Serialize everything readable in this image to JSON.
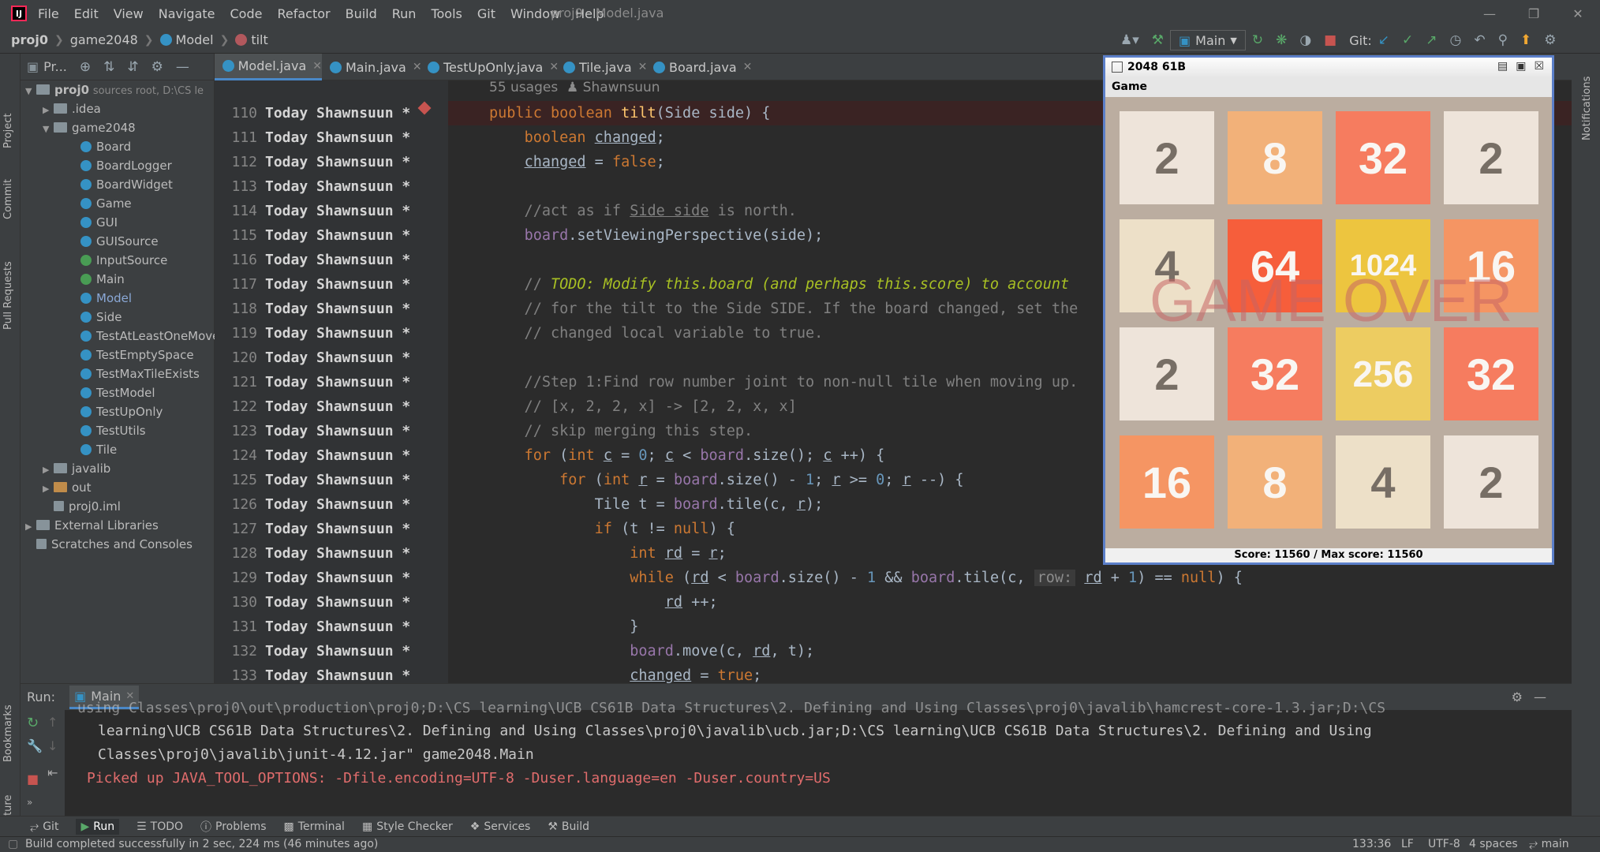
{
  "app": {
    "logo": "IJ",
    "window_title": "proj0 - Model.java",
    "menu": [
      "File",
      "Edit",
      "View",
      "Navigate",
      "Code",
      "Refactor",
      "Build",
      "Run",
      "Tools",
      "Git",
      "Window",
      "Help"
    ]
  },
  "breadcrumb": {
    "project": "proj0",
    "module": "game2048",
    "class": "Model",
    "method": "tilt"
  },
  "toolbar": {
    "run_config": "Main",
    "git_label": "Git:"
  },
  "project_panel": {
    "title": "Pr...",
    "items": [
      {
        "label": "proj0",
        "extra": "sources root, D:\\CS le"
      },
      {
        "label": ".idea"
      },
      {
        "label": "game2048"
      },
      {
        "label": "Board"
      },
      {
        "label": "BoardLogger"
      },
      {
        "label": "BoardWidget"
      },
      {
        "label": "Game"
      },
      {
        "label": "GUI"
      },
      {
        "label": "GUISource"
      },
      {
        "label": "InputSource"
      },
      {
        "label": "Main"
      },
      {
        "label": "Model"
      },
      {
        "label": "Side"
      },
      {
        "label": "TestAtLeastOneMoveE"
      },
      {
        "label": "TestEmptySpace"
      },
      {
        "label": "TestMaxTileExists"
      },
      {
        "label": "TestModel"
      },
      {
        "label": "TestUpOnly"
      },
      {
        "label": "TestUtils"
      },
      {
        "label": "Tile"
      },
      {
        "label": "javalib"
      },
      {
        "label": "out"
      },
      {
        "label": "proj0.iml"
      },
      {
        "label": "External Libraries"
      },
      {
        "label": "Scratches and Consoles"
      }
    ]
  },
  "editor_tabs": [
    "Model.java",
    "Main.java",
    "TestUpOnly.java",
    "Tile.java",
    "Board.java"
  ],
  "usages": "55 usages",
  "usage_author": "Shawnsuun",
  "annotation": {
    "date": "Today",
    "author": "Shawnsuun",
    "mark": "*"
  },
  "line_numbers": [
    "110",
    "111",
    "112",
    "113",
    "114",
    "115",
    "116",
    "117",
    "118",
    "119",
    "120",
    "121",
    "122",
    "123",
    "124",
    "125",
    "126",
    "127",
    "128",
    "129",
    "130",
    "131",
    "132",
    "133"
  ],
  "game": {
    "window_title": "2048 61B",
    "menu": "Game",
    "tiles": [
      "2",
      "8",
      "32",
      "2",
      "4",
      "64",
      "1024",
      "16",
      "2",
      "32",
      "256",
      "32",
      "16",
      "8",
      "4",
      "2"
    ],
    "overlay": "GAME OVER",
    "score_text": "Score:  11560 / Max score:  11560"
  },
  "run": {
    "label": "Run:",
    "tab": "Main",
    "lines": [
      "using Classes\\proj0\\out\\production\\proj0;D:\\CS learning\\UCB CS61B Data Structures\\2. Defining and Using Classes\\proj0\\javalib\\hamcrest-core-1.3.jar;D:\\CS",
      "learning\\UCB CS61B Data Structures\\2. Defining and Using Classes\\proj0\\javalib\\ucb.jar;D:\\CS learning\\UCB CS61B Data Structures\\2. Defining and Using",
      "Classes\\proj0\\javalib\\junit-4.12.jar\" game2048.Main",
      "Picked up JAVA_TOOL_OPTIONS: -Dfile.encoding=UTF-8 -Duser.language=en -Duser.country=US"
    ]
  },
  "bottom_tabs": [
    "Git",
    "Run",
    "TODO",
    "Problems",
    "Terminal",
    "Style Checker",
    "Services",
    "Build"
  ],
  "side_tabs": {
    "left": [
      "Project",
      "Commit",
      "Pull Requests",
      "Bookmarks",
      "Structure"
    ],
    "right": [
      "Notifications"
    ]
  },
  "status": {
    "message": "Build completed successfully in 2 sec, 224 ms (46 minutes ago)",
    "position": "133:36",
    "line_sep": "LF",
    "encoding": "UTF-8",
    "indent": "4 spaces",
    "branch": "main"
  },
  "colors": {
    "accent": "#4a88c7",
    "breakpoint": "#c75450"
  }
}
